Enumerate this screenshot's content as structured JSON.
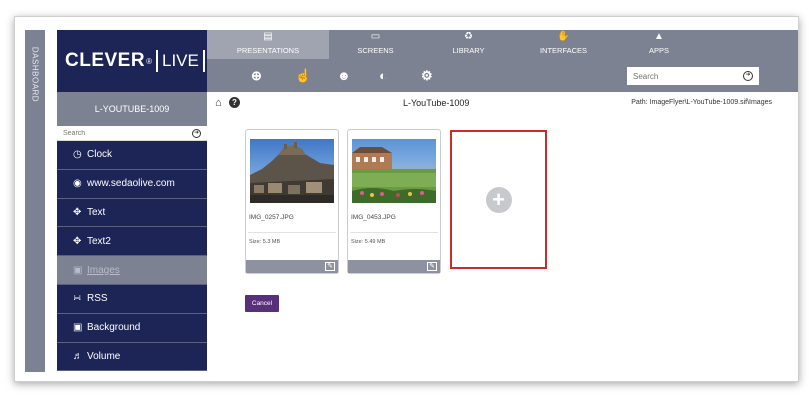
{
  "dashboard_label": "DASHBOARD",
  "logo": {
    "word1": "CLEVER",
    "reg": "®",
    "word2": "LIVE"
  },
  "sidebar": {
    "title": "L-YOUTUBE-1009",
    "search_placeholder": "Search",
    "items": [
      {
        "label": "Clock",
        "icon": "clock-icon"
      },
      {
        "label": "www.sedaolive.com",
        "icon": "chrome-icon"
      },
      {
        "label": "Text",
        "icon": "move-icon"
      },
      {
        "label": "Text2",
        "icon": "move-icon"
      },
      {
        "label": "Images",
        "icon": "image-icon"
      },
      {
        "label": "RSS",
        "icon": "rss-icon"
      },
      {
        "label": "Background",
        "icon": "image-icon"
      },
      {
        "label": "Volume",
        "icon": "volume-icon"
      }
    ]
  },
  "topnav": {
    "tabs": [
      {
        "label": "PRESENTATIONS",
        "icon": "presentation-icon"
      },
      {
        "label": "SCREENS",
        "icon": "monitor-icon"
      },
      {
        "label": "LIBRARY",
        "icon": "library-icon"
      },
      {
        "label": "INTERFACES",
        "icon": "interface-icon"
      },
      {
        "label": "APPS",
        "icon": "android-icon"
      }
    ],
    "active": "PRESENTATIONS"
  },
  "toolbar": {
    "tools": [
      "add-icon",
      "touch-icon",
      "users-icon",
      "gamepad-icon",
      "gear-icon"
    ],
    "search_placeholder": "Search"
  },
  "header": {
    "title": "L-YouTube-1009",
    "path": "Path: ImageFlyer\\L-YouTube-1009.sif\\Images"
  },
  "cards": [
    {
      "filename": "IMG_0257.JPG",
      "size": "Size: 5.3 MB"
    },
    {
      "filename": "IMG_0453.JPG",
      "size": "Size: 5.49 MB"
    }
  ],
  "cancel_label": "Cancel",
  "colors": {
    "navy": "#1c2555",
    "slate": "#7d8292",
    "highlight": "#cc2b2b",
    "cancel": "#58307a"
  }
}
